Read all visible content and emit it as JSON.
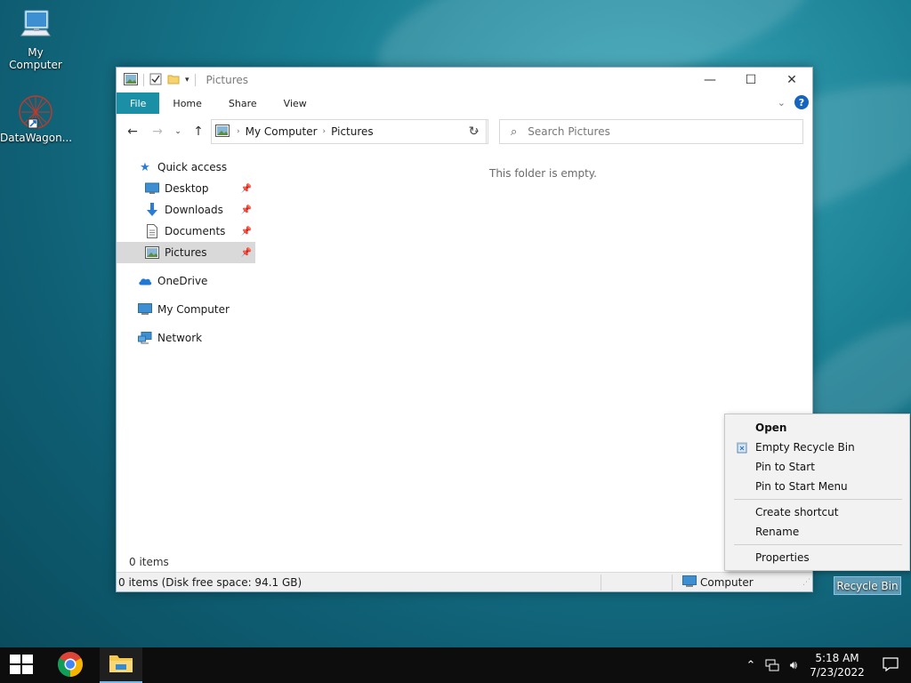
{
  "desktop": {
    "icons": [
      {
        "label": "My Computer"
      },
      {
        "label": "DataWagon..."
      }
    ],
    "recycle_bin_label": "Recycle Bin"
  },
  "window": {
    "title": "Pictures",
    "ribbon_tabs": [
      "File",
      "Home",
      "Share",
      "View"
    ],
    "help_label": "?",
    "breadcrumb": [
      "My Computer",
      "Pictures"
    ],
    "search_placeholder": "Search Pictures",
    "empty_message": "This folder is empty.",
    "nav": {
      "quick_access": "Quick access",
      "pinned": [
        {
          "label": "Desktop",
          "icon": "desktop-icon"
        },
        {
          "label": "Downloads",
          "icon": "download-arrow-icon"
        },
        {
          "label": "Documents",
          "icon": "document-icon"
        },
        {
          "label": "Pictures",
          "icon": "pictures-icon"
        }
      ],
      "onedrive": "OneDrive",
      "my_computer": "My Computer",
      "network": "Network"
    },
    "items_count": "0 items",
    "status_left": "0 items (Disk free space: 94.1 GB)",
    "status_right": "Computer"
  },
  "context_menu": {
    "items": [
      "Open",
      "Empty Recycle Bin",
      "Pin to Start",
      "Pin to Start Menu",
      "Create shortcut",
      "Rename",
      "Properties"
    ]
  },
  "taskbar": {
    "time": "5:18 AM",
    "date": "7/23/2022"
  },
  "colors": {
    "file_tab": "#1a8fa6",
    "selection": "#d9d9d9",
    "taskbar": "#0d0d0d"
  }
}
